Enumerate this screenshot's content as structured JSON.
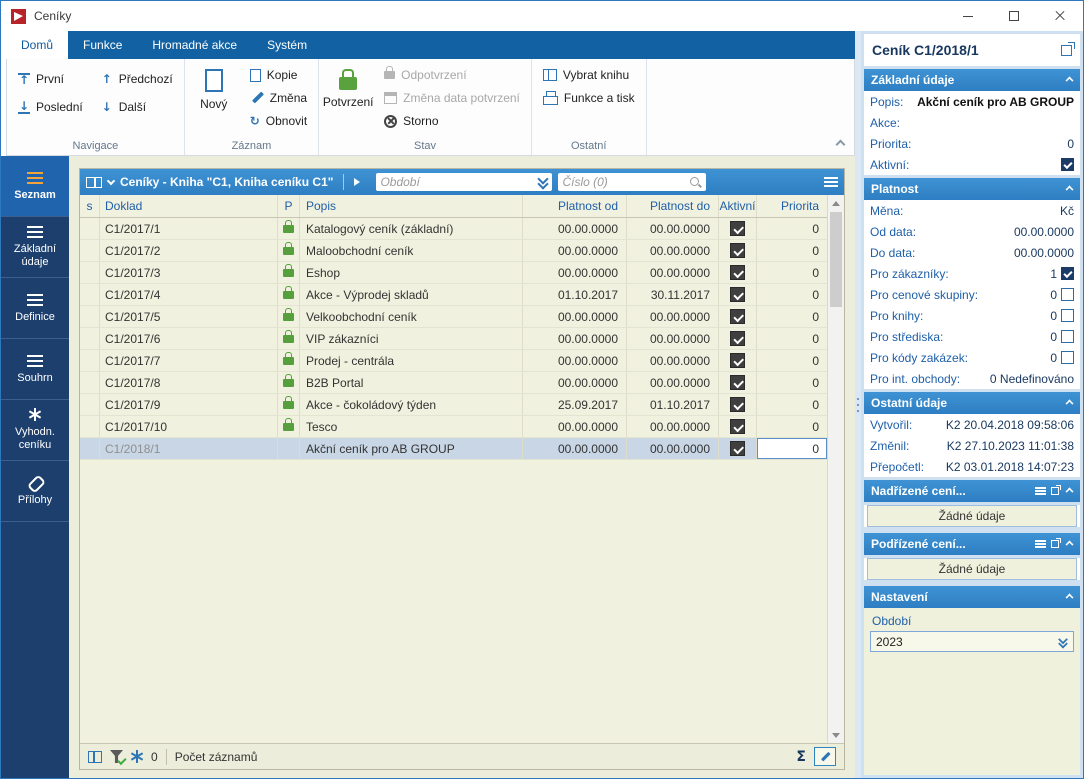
{
  "window": {
    "title": "Ceníky"
  },
  "icons": {
    "first": "↑",
    "last": "↓",
    "previous": "↑",
    "next": "↓",
    "refresh": "↻",
    "sum": "Σ"
  },
  "tabs": [
    {
      "label": "Domů",
      "active": true
    },
    {
      "label": "Funkce",
      "active": false
    },
    {
      "label": "Hromadné akce",
      "active": false
    },
    {
      "label": "Systém",
      "active": false
    }
  ],
  "ribbon": {
    "navigace": {
      "label": "Navigace",
      "prvni": "První",
      "posledni": "Poslední",
      "predchozi": "Předchozí",
      "dalsi": "Další"
    },
    "zaznam": {
      "label": "Záznam",
      "novy": "Nový",
      "kopie": "Kopie",
      "zmena": "Změna",
      "obnovit": "Obnovit"
    },
    "stav": {
      "label": "Stav",
      "potvrzeni": "Potvrzení",
      "odpotvrzeni": "Odpotvrzení",
      "zmena_data": "Změna data potvrzení",
      "storno": "Storno"
    },
    "ostatni": {
      "label": "Ostatní",
      "vybrat_knihu": "Vybrat knihu",
      "funkce_a_tisk": "Funkce a tisk"
    }
  },
  "sidebar": {
    "items": [
      {
        "label": "Seznam",
        "active": true,
        "icon": "list"
      },
      {
        "label": "Základní údaje",
        "active": false,
        "icon": "list"
      },
      {
        "label": "Definice",
        "active": false,
        "icon": "list"
      },
      {
        "label": "Souhrn",
        "active": false,
        "icon": "list"
      },
      {
        "label": "Vyhodn. ceníku",
        "active": false,
        "icon": "burst"
      },
      {
        "label": "Přílohy",
        "active": false,
        "icon": "clip"
      }
    ]
  },
  "browser": {
    "title": "Ceníky - Kniha \"C1, Kniha ceníku C1\"",
    "filters": {
      "obdobi": "Období",
      "cislo": "Číslo (0)"
    },
    "columns": {
      "s": "s",
      "doklad": "Doklad",
      "p": "P",
      "popis": "Popis",
      "od": "Platnost od",
      "do": "Platnost do",
      "aktivni": "Aktivní",
      "priorita": "Priorita"
    },
    "rows": [
      {
        "doklad": "C1/2017/1",
        "locked": true,
        "popis": "Katalogový ceník (základní)",
        "od": "00.00.0000",
        "do": "00.00.0000",
        "priorita": "0",
        "selected": false,
        "muted": false,
        "editing": false
      },
      {
        "doklad": "C1/2017/2",
        "locked": true,
        "popis": "Maloobchodní ceník",
        "od": "00.00.0000",
        "do": "00.00.0000",
        "priorita": "0",
        "selected": false,
        "muted": false,
        "editing": false
      },
      {
        "doklad": "C1/2017/3",
        "locked": true,
        "popis": "Eshop",
        "od": "00.00.0000",
        "do": "00.00.0000",
        "priorita": "0",
        "selected": false,
        "muted": false,
        "editing": false
      },
      {
        "doklad": "C1/2017/4",
        "locked": true,
        "popis": "Akce - Výprodej skladů",
        "od": "01.10.2017",
        "do": "30.11.2017",
        "priorita": "0",
        "selected": false,
        "muted": false,
        "editing": false
      },
      {
        "doklad": "C1/2017/5",
        "locked": true,
        "popis": "Velkoobchodní ceník",
        "od": "00.00.0000",
        "do": "00.00.0000",
        "priorita": "0",
        "selected": false,
        "muted": false,
        "editing": false
      },
      {
        "doklad": "C1/2017/6",
        "locked": true,
        "popis": "VIP zákazníci",
        "od": "00.00.0000",
        "do": "00.00.0000",
        "priorita": "0",
        "selected": false,
        "muted": false,
        "editing": false
      },
      {
        "doklad": "C1/2017/7",
        "locked": true,
        "popis": "Prodej - centrála",
        "od": "00.00.0000",
        "do": "00.00.0000",
        "priorita": "0",
        "selected": false,
        "muted": false,
        "editing": false
      },
      {
        "doklad": "C1/2017/8",
        "locked": true,
        "popis": "B2B Portal",
        "od": "00.00.0000",
        "do": "00.00.0000",
        "priorita": "0",
        "selected": false,
        "muted": false,
        "editing": false
      },
      {
        "doklad": "C1/2017/9",
        "locked": true,
        "popis": "Akce - čokoládový týden",
        "od": "25.09.2017",
        "do": "01.10.2017",
        "priorita": "0",
        "selected": false,
        "muted": false,
        "editing": false
      },
      {
        "doklad": "C1/2017/10",
        "locked": true,
        "popis": "Tesco",
        "od": "00.00.0000",
        "do": "00.00.0000",
        "priorita": "0",
        "selected": false,
        "muted": false,
        "editing": false
      },
      {
        "doklad": "C1/2018/1",
        "locked": false,
        "popis": "Akční ceník pro AB GROUP",
        "od": "00.00.0000",
        "do": "00.00.0000",
        "priorita": "0",
        "selected": true,
        "muted": true,
        "editing": true
      }
    ],
    "status": {
      "count": "0",
      "count_label": "Počet záznamů"
    }
  },
  "panel": {
    "title": "Ceník C1/2018/1",
    "zakladni": {
      "title": "Základní údaje",
      "fields": [
        {
          "label": "Popis:",
          "value": "Akční ceník pro AB GROUP",
          "bold": true,
          "has_checkbox": false,
          "checked": false
        },
        {
          "label": "Akce:",
          "value": "",
          "bold": false,
          "has_checkbox": false,
          "checked": false
        },
        {
          "label": "Priorita:",
          "value": "0",
          "bold": false,
          "has_checkbox": false,
          "checked": false
        },
        {
          "label": "Aktivní:",
          "value": "",
          "bold": false,
          "has_checkbox": true,
          "checked": true
        }
      ]
    },
    "platnost": {
      "title": "Platnost",
      "fields": [
        {
          "label": "Měna:",
          "value": "Kč",
          "has_checkbox": false,
          "checked": false
        },
        {
          "label": "Od data:",
          "value": "00.00.0000",
          "has_checkbox": false,
          "checked": false
        },
        {
          "label": "Do data:",
          "value": "00.00.0000",
          "has_checkbox": false,
          "checked": false
        },
        {
          "label": "Pro zákazníky:",
          "value": "1",
          "has_checkbox": true,
          "checked": true
        },
        {
          "label": "Pro cenové skupiny:",
          "value": "0",
          "has_checkbox": true,
          "checked": false
        },
        {
          "label": "Pro knihy:",
          "value": "0",
          "has_checkbox": true,
          "checked": false
        },
        {
          "label": "Pro střediska:",
          "value": "0",
          "has_checkbox": true,
          "checked": false
        },
        {
          "label": "Pro kódy zakázek:",
          "value": "0",
          "has_checkbox": true,
          "checked": false
        },
        {
          "label": "Pro int. obchody:",
          "value": "0 Nedefinováno",
          "has_checkbox": false,
          "checked": false
        }
      ]
    },
    "ostatni": {
      "title": "Ostatní údaje",
      "fields": [
        {
          "label": "Vytvořil:",
          "value": "K2 20.04.2018 09:58:06",
          "has_checkbox": false,
          "checked": false
        },
        {
          "label": "Změnil:",
          "value": "K2 27.10.2023 11:01:38",
          "has_checkbox": false,
          "checked": false
        },
        {
          "label": "Přepočetl:",
          "value": "K2 03.01.2018 14:07:23",
          "has_checkbox": false,
          "checked": false
        }
      ]
    },
    "nadrizene": {
      "title": "Nadřízené cení...",
      "empty": "Žádné údaje"
    },
    "podrizene": {
      "title": "Podřízené cení...",
      "empty": "Žádné údaje"
    },
    "nastaveni": {
      "title": "Nastavení",
      "obdobi_label": "Období",
      "obdobi_value": "2023"
    }
  }
}
